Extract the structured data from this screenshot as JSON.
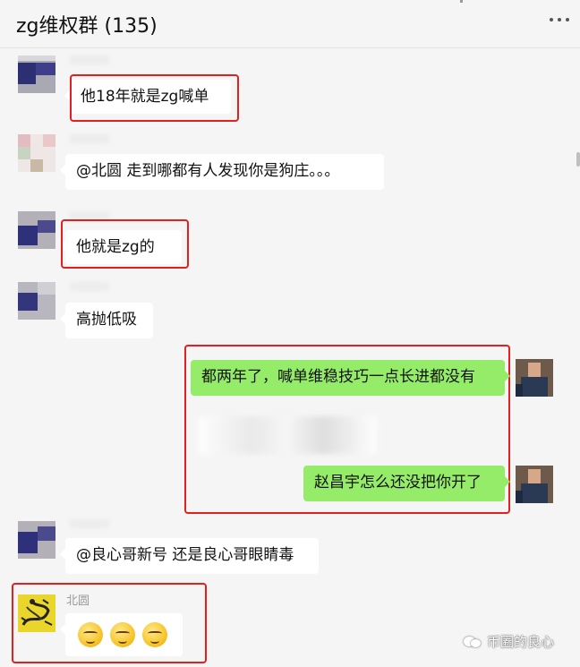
{
  "chat": {
    "title": "zg维权群 (135)"
  },
  "messages": [
    {
      "text": "他18年就是zg喊单"
    },
    {
      "text": "@北圆 走到哪都有人发现你是狗庄。。。"
    },
    {
      "text": "他就是zg的"
    },
    {
      "text": "高抛低吸"
    },
    {
      "text": "都两年了，喊单维稳技巧一点长进都没有"
    },
    {
      "text": "赵昌宇怎么还没把你开了"
    },
    {
      "text": "@良心哥新号 还是良心哥眼睛毒"
    },
    {
      "sender": "北圆"
    }
  ],
  "watermark": {
    "text": "币圈的良心"
  },
  "icons": {
    "more": "more-horizontal-icon",
    "watermark": "wechat-icon"
  }
}
